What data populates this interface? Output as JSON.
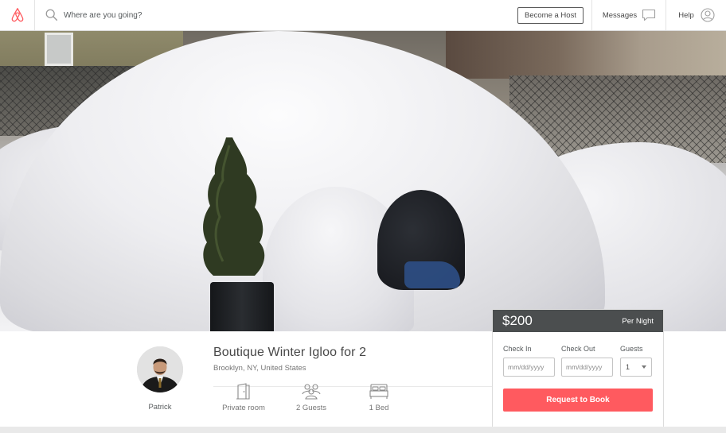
{
  "header": {
    "search_placeholder": "Where are you going?",
    "become_host_label": "Become a Host",
    "messages_label": "Messages",
    "help_label": "Help"
  },
  "listing": {
    "title": "Boutique Winter Igloo for 2",
    "location": "Brooklyn, NY, United States",
    "host_name": "Patrick",
    "amenities": [
      {
        "icon": "door-icon",
        "label": "Private room"
      },
      {
        "icon": "people-icon",
        "label": "2 Guests"
      },
      {
        "icon": "bed-icon",
        "label": "1 Bed"
      }
    ]
  },
  "booking": {
    "price": "$200",
    "per_label": "Per Night",
    "check_in_label": "Check In",
    "check_out_label": "Check Out",
    "guests_label": "Guests",
    "date_placeholder": "mm/dd/yyyy",
    "guests_value": "1",
    "request_label": "Request to Book"
  },
  "colors": {
    "brand": "#ff5a5f",
    "price_bar": "#3c3f40"
  }
}
